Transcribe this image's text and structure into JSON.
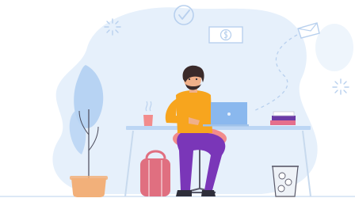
{
  "colors": {
    "background": "#ffffff",
    "blob": "#e6f0fb",
    "blob_light": "#eef5fc",
    "icon_line": "#b8d0ee",
    "desk": "#bcd6f4",
    "desk_leg": "#c8daee",
    "shirt": "#f7a51e",
    "pants": "#7a36b8",
    "hair": "#3a2a2a",
    "skin": "#f0b08a",
    "chair": "#f28c8c",
    "backpack": "#e06f80",
    "pot": "#f2b07a",
    "leaf": "#b7d3f3",
    "laptop": "#8ab8ee",
    "mug": "#f28c8c",
    "books_purple": "#6b3aa6",
    "books_pink": "#e56f8c",
    "bin": "#eef2f7",
    "floor": "#b8d0ee"
  },
  "icons": [
    "checkmark-circle-icon",
    "dollar-bill-icon",
    "paper-plane-icon",
    "sparkle-icon",
    "sparkle-icon"
  ]
}
